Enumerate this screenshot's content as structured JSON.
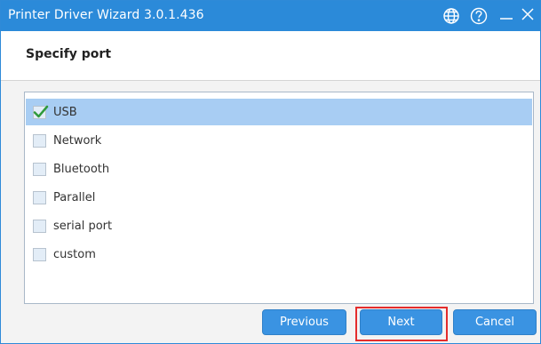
{
  "window": {
    "title": "Printer Driver Wizard  3.0.1.436",
    "icons": [
      "globe-icon",
      "help-icon",
      "minimize-icon",
      "close-icon"
    ]
  },
  "page": {
    "title": "Specify port"
  },
  "ports": [
    {
      "label": "USB",
      "checked": true
    },
    {
      "label": "Network",
      "checked": false
    },
    {
      "label": "Bluetooth",
      "checked": false
    },
    {
      "label": "Parallel",
      "checked": false
    },
    {
      "label": "serial port",
      "checked": false
    },
    {
      "label": "custom",
      "checked": false
    }
  ],
  "buttons": {
    "previous": "Previous",
    "next": "Next",
    "cancel": "Cancel"
  },
  "colors": {
    "titlebar": "#2b8ad9",
    "selected_row": "#a8cdf3",
    "button": "#3a93e2",
    "highlight": "#e42c2c"
  }
}
